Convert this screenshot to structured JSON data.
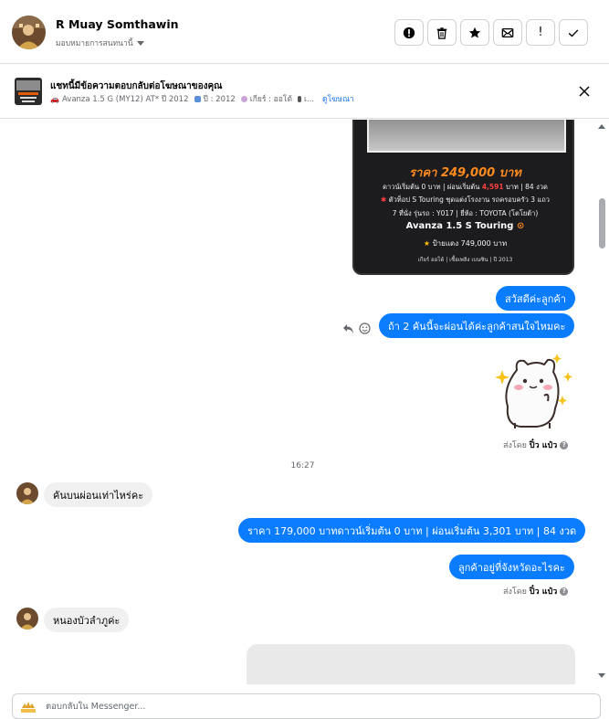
{
  "header": {
    "name": "R Muay Somthawin",
    "assign_label": "มอบหมายการสนทนานี้",
    "actions": [
      {
        "icon": "alert-circle-icon"
      },
      {
        "icon": "trash-icon"
      },
      {
        "icon": "star-icon"
      },
      {
        "icon": "mark-unread-icon"
      },
      {
        "icon": "exclamation-icon",
        "text": "!"
      },
      {
        "icon": "check-icon"
      }
    ]
  },
  "ad_bar": {
    "title": "แชทนี้มีข้อความตอบกลับต่อโฆษณาของคุณ",
    "details": "Avanza 1.5 G (MY12) AT* ปี 2012",
    "year": "ปี : 2012",
    "gear": "เกียร์ : ออโต้",
    "ellipsis": "เ...",
    "view_ad": "ดูโฆษณา"
  },
  "ad_card": {
    "price": "ราคา 249,000 บาท",
    "down_prefix": "ดาวน์เริ่มต้น 0 บาท | ผ่อนเริ่มต้น",
    "down_red": "4,591",
    "down_suffix": "บาท | 84 งวด",
    "feature_line": "ตัวท็อป S Touring ชุดแต่งโรงงาน รถครอบครัว 3 แถว",
    "seats_line": "7 ที่นั่ง  รุ่นรถ : Y017 | ยี่ห้อ : TOYOTA (โตโยต้า)",
    "model": "Avanza 1.5 S Touring",
    "plate": "ป้ายแดง 749,000 บาท",
    "footer": "เกียร์ ออโต้  |  เชื้อเพลิง เบนซิน  |  ปี 2013"
  },
  "messages": {
    "out_1": "สวัสดีค่ะลูกค้า",
    "out_2": "ถ้า 2 คันนี้จะผ่อนได้ค่ะลูกค้าสนใจไหมคะ",
    "sent_by_1_prefix": "ส่งโดย",
    "sent_by_1_name": "ปิ๋ว แป๋ว",
    "timestamp": "16:27",
    "in_1": "คันบนผ่อนเท่าไหร่คะ",
    "out_3": "ราคา 179,000 บาทดาวน์เริ่มต้น 0 บาท | ผ่อนเริ่มต้น 3,301 บาท | 84 งวด",
    "out_4": "ลูกค้าอยู่ที่จังหวัดอะไรคะ",
    "sent_by_2_prefix": "ส่งโดย",
    "sent_by_2_name": "ปิ๋ว แป๋ว",
    "in_2": "หนองบัวลำภูค่ะ"
  },
  "composer": {
    "placeholder": "ตอบกลับใน Messenger..."
  },
  "colors": {
    "accent": "#0a7cff",
    "link": "#1877f2",
    "price_orange": "#ff8a1d"
  }
}
